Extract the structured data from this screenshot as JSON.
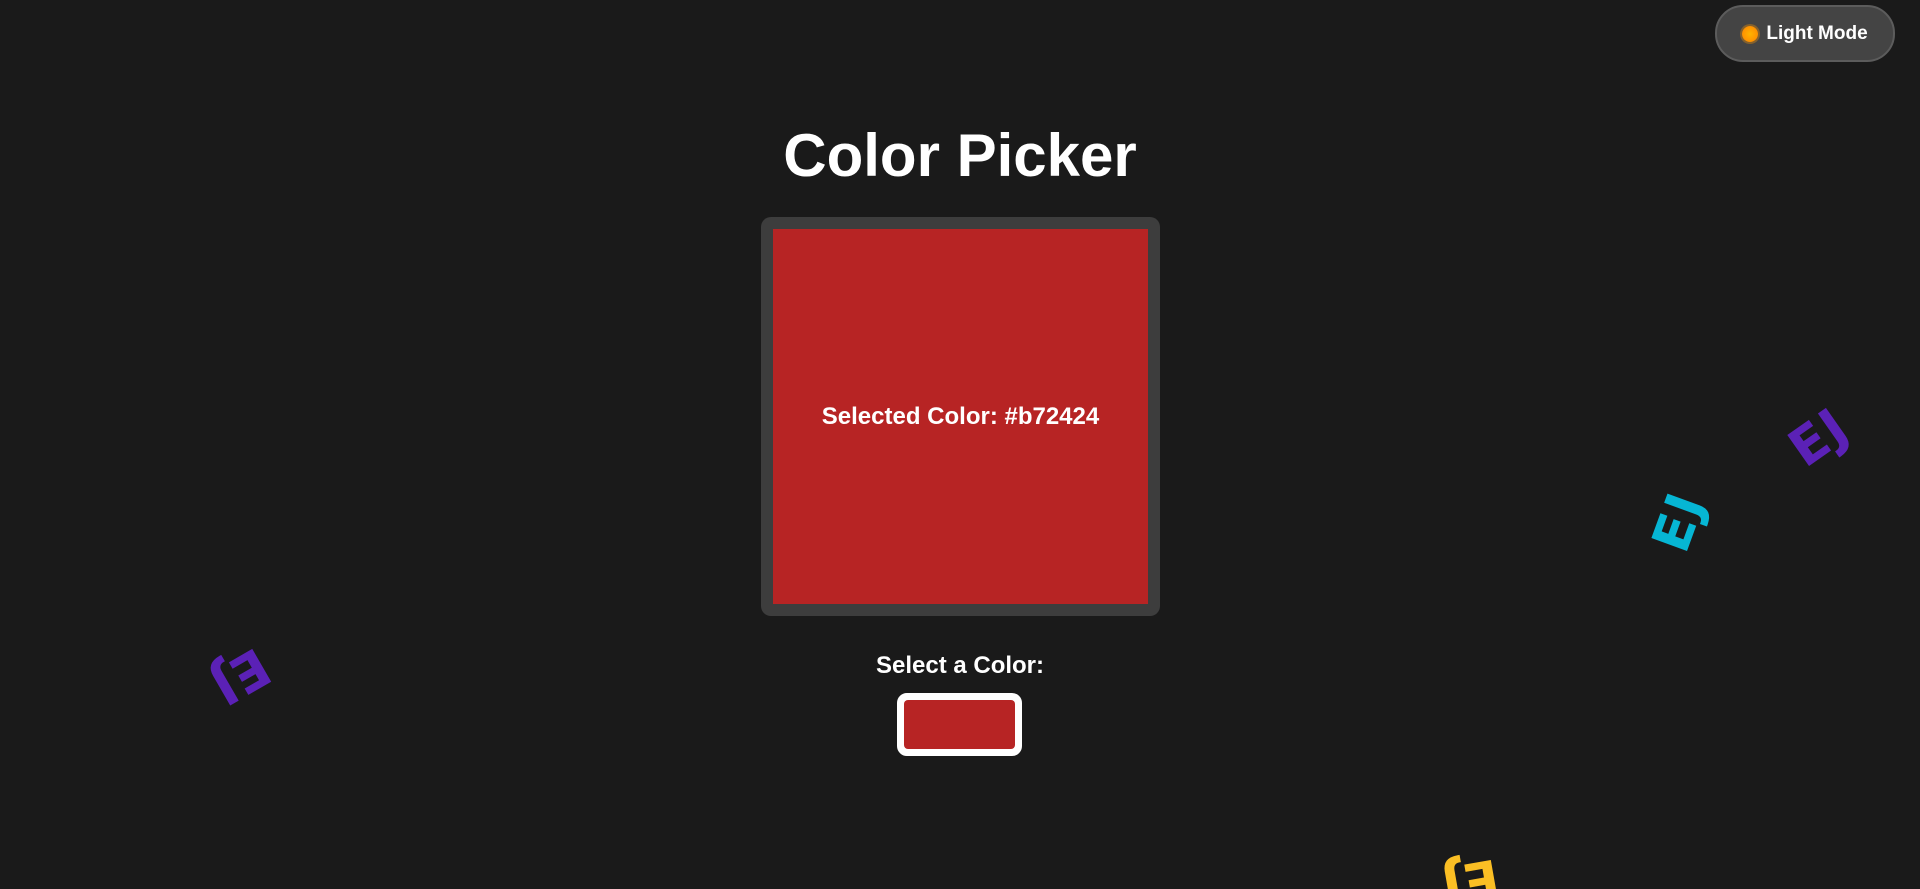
{
  "theme_toggle": {
    "label": "Light Mode",
    "icon": "sun-icon"
  },
  "header": {
    "title": "Color Picker"
  },
  "preview": {
    "text": "Selected Color: #b72424",
    "color": "#b72424"
  },
  "picker": {
    "label": "Select a Color:",
    "value": "#b72424"
  },
  "floating_logos": [
    {
      "text": "EJ",
      "color": "#5b21b6"
    },
    {
      "text": "EJ",
      "color": "#06b6d4"
    },
    {
      "text": "EJ",
      "color": "#5b21b6"
    },
    {
      "text": "EJ",
      "color": "#fbbf24"
    }
  ],
  "colors": {
    "background": "#1a1a1a",
    "frame": "#3d3d3d",
    "toggle": "#444444"
  }
}
